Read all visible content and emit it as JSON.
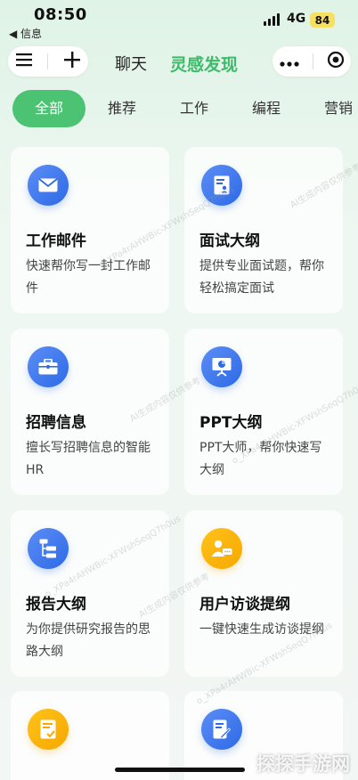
{
  "status": {
    "time": "08:50",
    "back_app": "◀ 信息",
    "network": "4G",
    "battery": "84"
  },
  "nav": {
    "tab_chat": "聊天",
    "tab_discover": "灵感发现"
  },
  "categories": [
    "全部",
    "推荐",
    "工作",
    "编程",
    "营销"
  ],
  "cards": [
    {
      "title": "工作邮件",
      "desc": "快速帮你写一封工作邮件",
      "icon": "mail-icon",
      "color": "blue"
    },
    {
      "title": "面试大纲",
      "desc": "提供专业面试题，帮你轻松搞定面试",
      "icon": "resume-icon",
      "color": "blue"
    },
    {
      "title": "招聘信息",
      "desc": "擅长写招聘信息的智能HR",
      "icon": "briefcase-icon",
      "color": "blue"
    },
    {
      "title": "PPT大纲",
      "desc": "PPT大师，帮你快速写大纲",
      "icon": "presentation-icon",
      "color": "blue"
    },
    {
      "title": "报告大纲",
      "desc": "为你提供研究报告的思路大纲",
      "icon": "outline-tree-icon",
      "color": "blue"
    },
    {
      "title": "用户访谈提纲",
      "desc": "一键快速生成访谈提纲",
      "icon": "user-chat-icon",
      "color": "yellow"
    },
    {
      "title": "",
      "desc": "",
      "icon": "doc-check-icon",
      "color": "yellow"
    },
    {
      "title": "",
      "desc": "",
      "icon": "doc-edit-icon",
      "color": "blue"
    }
  ],
  "watermark": {
    "line1": "AI生成内容仅供参考",
    "line2": "o_XPa4rAHWBic-XFWshSeqQ7h0us"
  },
  "corner_logo": "探探手游网",
  "colors": {
    "accent_green": "#4cc273",
    "icon_blue": "#2e6ae6",
    "icon_yellow": "#f6a800"
  }
}
